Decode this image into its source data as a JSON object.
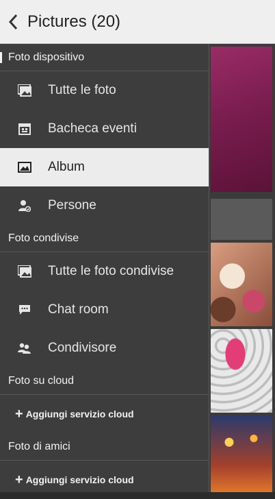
{
  "header": {
    "title": "Pictures (20)"
  },
  "drawer": {
    "sections": [
      {
        "title": "Foto dispositivo",
        "items": [
          {
            "label": "Tutte le foto",
            "icon": "photos-icon"
          },
          {
            "label": "Bacheca eventi",
            "icon": "calendar-icon"
          },
          {
            "label": "Album",
            "icon": "album-icon",
            "selected": true
          },
          {
            "label": "Persone",
            "icon": "person-icon"
          }
        ]
      },
      {
        "title": "Foto condivise",
        "items": [
          {
            "label": "Tutte le foto condivise",
            "icon": "photos-icon"
          },
          {
            "label": "Chat room",
            "icon": "chat-icon"
          },
          {
            "label": "Condivisore",
            "icon": "people-icon"
          }
        ]
      },
      {
        "title": "Foto su cloud",
        "action": "Aggiungi servizio cloud"
      },
      {
        "title": "Foto di amici",
        "action": "Aggiungi servizio cloud"
      }
    ]
  },
  "colors": {
    "drawer_bg": "#3d3d3d",
    "selected_bg": "#ececec",
    "header_bg": "#efefef"
  }
}
